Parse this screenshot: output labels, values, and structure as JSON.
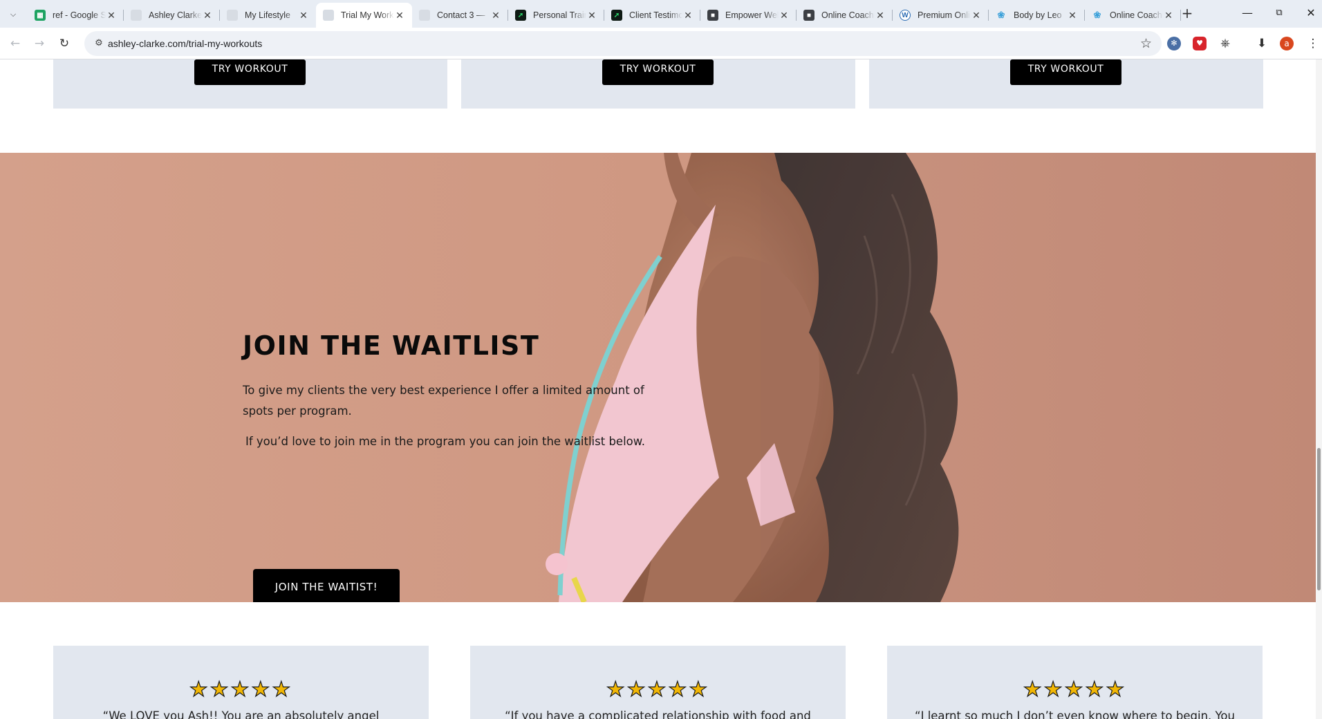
{
  "browser": {
    "tabs": [
      {
        "title": "ref - Google Sheets",
        "favicon": "sheets-icon"
      },
      {
        "title": "Ashley Clarke",
        "favicon": "blank-page-icon"
      },
      {
        "title": "My Lifestyle",
        "favicon": "blank-page-icon"
      },
      {
        "title": "Trial My Workouts",
        "favicon": "blank-page-icon",
        "active": true
      },
      {
        "title": "Contact 3 —",
        "favicon": "blank-page-icon"
      },
      {
        "title": "Personal Trainer",
        "favicon": "chart-icon"
      },
      {
        "title": "Client Testimonials",
        "favicon": "chart-icon"
      },
      {
        "title": "Empower Wellness",
        "favicon": "box-icon"
      },
      {
        "title": "Online Coaching",
        "favicon": "box-icon"
      },
      {
        "title": "Premium Online",
        "favicon": "wordpress-icon"
      },
      {
        "title": "Body by Leo",
        "favicon": "leaf-icon"
      },
      {
        "title": "Online Coaching",
        "favicon": "leaf-icon"
      }
    ],
    "url": "ashley-clarke.com/trial-my-workouts",
    "profile_initial": "a"
  },
  "workouts": {
    "buttons": [
      "TRY WORKOUT",
      "TRY WORKOUT",
      "TRY WORKOUT"
    ]
  },
  "waitlist": {
    "title": "JOIN THE WAITLIST",
    "paragraph_line1": "To give my clients the very best experience I offer a limited amount of",
    "paragraph_line2": "spots per program.",
    "paragraph2": "If you’d love to join me in the program you can join the waitlist below.",
    "button": "JOIN THE WAITIST!"
  },
  "reviews": [
    {
      "stars": "★★★★★",
      "rating": 5,
      "quote": "“We LOVE you Ash!! You are an absolutely angel"
    },
    {
      "stars": "★★★★★",
      "rating": 5,
      "quote": "“If you have a complicated relationship with food and"
    },
    {
      "stars": "★★★★★",
      "rating": 5,
      "quote": "“I learnt so much I don’t even know where to begin. You"
    }
  ],
  "colors": {
    "hero_bg": "#d4a08b",
    "card_bg": "#e2e7ef",
    "button_bg": "#000000",
    "star_fill": "#f2b705"
  }
}
